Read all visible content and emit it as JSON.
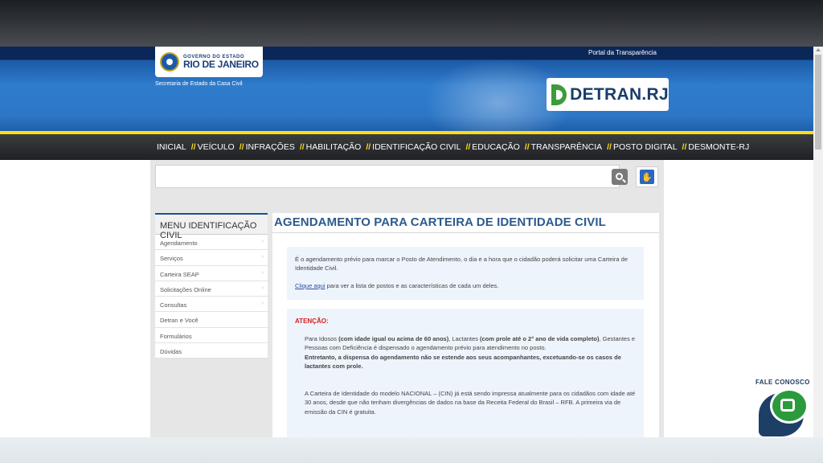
{
  "header": {
    "portal_link": "Portal da Transparência",
    "gov_logo": {
      "line1": "GOVERNO DO ESTADO",
      "line2": "RIO DE JANEIRO"
    },
    "secretaria": "Secretaria de Estado da Casa Civil",
    "detran_logo": "DETRAN.RJ"
  },
  "nav": {
    "items": [
      "INICIAL",
      "VEÍCULO",
      "INFRAÇÕES",
      "HABILITAÇÃO",
      "IDENTIFICAÇÃO CIVIL",
      "EDUCAÇÃO",
      "TRANSPARÊNCIA",
      "POSTO DIGITAL",
      "DESMONTE-RJ"
    ],
    "separator": "//"
  },
  "search": {
    "placeholder": ""
  },
  "sidemenu": {
    "title": "MENU IDENTIFICAÇÃO CIVIL",
    "items": [
      {
        "label": "Agendamento",
        "arrow": "›"
      },
      {
        "label": "Serviços",
        "arrow": "›"
      },
      {
        "label": "Carteira SEAP",
        "arrow": "›"
      },
      {
        "label": "Solicitações Online",
        "arrow": "›"
      },
      {
        "label": "Consultas",
        "arrow": "›"
      },
      {
        "label": "Detran e Você",
        "arrow": ""
      },
      {
        "label": "Formulários",
        "arrow": ""
      },
      {
        "label": "Dúvidas",
        "arrow": ""
      }
    ]
  },
  "content": {
    "title": "AGENDAMENTO PARA CARTEIRA DE IDENTIDADE CIVIL",
    "intro": "É o agendamento prévio para marcar o Posto de Atendimento, o dia e a hora que o cidadão poderá solicitar uma Carteira de Identidade Civil.",
    "link_text": "Clique aqui",
    "link_rest": " para ver a lista de postos e as características de cada um deles.",
    "attention_label": "ATENÇÃO:",
    "p1_a": "Para Idosos ",
    "p1_b": "(com idade igual ou acima de 60 anos)",
    "p1_c": ", Lactantes ",
    "p1_d": "(com prole até o 2° ano de vida completo)",
    "p1_e": ", Gestantes e Pessoas com Deficiência é dispensado o agendamento prévio para atendimento no posto.",
    "p1_bold": "Entretanto, a dispensa do agendamento não se estende aos seus acompanhantes, excetuando-se os casos de lactantes com prole.",
    "p2": "A Carteira de Identidade do modelo NACIONAL – (CIN) já está sendo impressa atualmente para os cidadãos com idade até 30 anos, desde que não tenham divergências de dados na base da Receita Federal do Brasil – RFB. A primeira via de emissão da CIN é gratuita."
  },
  "chat": {
    "label": "FALE CONOSCO"
  },
  "colors": {
    "nav_accent": "#ffdb1a",
    "title_blue": "#2d5a8c",
    "attention_red": "#d42020",
    "box_bg": "#eef4fb"
  }
}
